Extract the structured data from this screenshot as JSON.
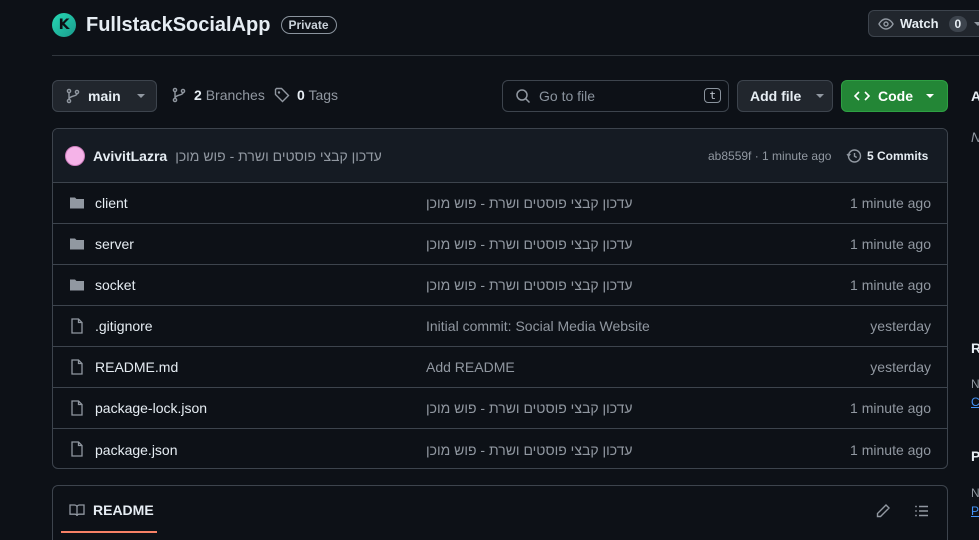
{
  "repo": {
    "initial": "K",
    "name": "FullstackSocialApp",
    "visibility": "Private"
  },
  "watch": {
    "label": "Watch",
    "count": "0"
  },
  "toolbar": {
    "branch": "main",
    "branches_count": "2",
    "branches_label": "Branches",
    "tags_count": "0",
    "tags_label": "Tags",
    "goto_placeholder": "Go to file",
    "goto_shortcut": "t",
    "add_file": "Add file",
    "code": "Code"
  },
  "commit": {
    "author": "AvivitLazra",
    "message": "עדכון קבצי פוסטים ושרת - פוש מוכן",
    "meta": "ab8559f · 1 minute ago",
    "commits": "5 Commits"
  },
  "files": [
    {
      "type": "folder",
      "name": "client",
      "message": "עדכון קבצי פוסטים ושרת - פוש מוכן",
      "time": "1 minute ago"
    },
    {
      "type": "folder",
      "name": "server",
      "message": "עדכון קבצי פוסטים ושרת - פוש מוכן",
      "time": "1 minute ago"
    },
    {
      "type": "folder",
      "name": "socket",
      "message": "עדכון קבצי פוסטים ושרת - פוש מוכן",
      "time": "1 minute ago"
    },
    {
      "type": "file",
      "name": ".gitignore",
      "message": "Initial commit: Social Media Website",
      "time": "yesterday"
    },
    {
      "type": "file",
      "name": "README.md",
      "message": "Add README",
      "time": "yesterday"
    },
    {
      "type": "file",
      "name": "package-lock.json",
      "message": "עדכון קבצי פוסטים ושרת - פוש מוכן",
      "time": "1 minute ago"
    },
    {
      "type": "file",
      "name": "package.json",
      "message": "עדכון קבצי פוסטים ושרת - פוש מוכן",
      "time": "1 minute ago"
    }
  ],
  "readme": {
    "tab": "README"
  },
  "sidebar": {
    "about_initial": "A",
    "about_desc_initial": "N",
    "releases_initial": "R",
    "releases_none": "N",
    "releases_link": "C",
    "packages_initial": "P",
    "packages_none": "N",
    "packages_link": "P"
  },
  "colors": {
    "bg": "#0d1117",
    "border": "#3d444d",
    "accent_green": "#238636",
    "link": "#4493f8"
  }
}
